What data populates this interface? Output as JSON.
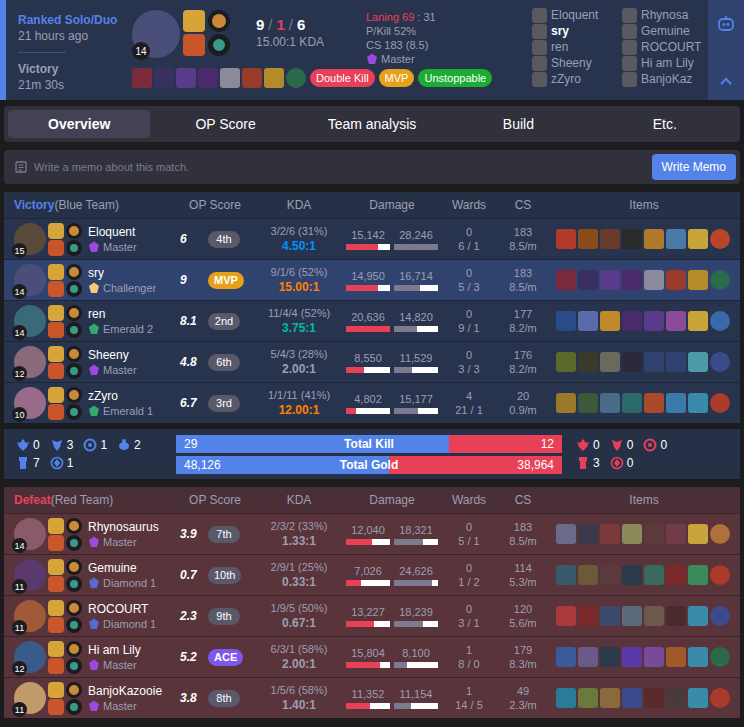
{
  "header": {
    "queue": "Ranked Solo/Duo",
    "time_ago": "21 hours ago",
    "result": "Victory",
    "duration": "21m 30s",
    "champion_level": "14",
    "portrait_color": "#4a4f7a",
    "kda_kills": "9",
    "kda_deaths": "1",
    "kda_assists": "6",
    "kda_separator": "/",
    "kda_ratio": "15.00:1 KDA",
    "laning": "Laning 69",
    "laning_rest": ": 31",
    "pkill": "P/Kill 52%",
    "cs": "CS 183 (8.5)",
    "rank": "Master",
    "rank_color": "#9d48e0",
    "items": [
      "#7a2a3a",
      "#3a3060",
      "#5a3a8a",
      "#4a2a6a",
      "#8a8a9a",
      "#9a3a2a",
      "#b58b2a",
      "#2a6a4a"
    ],
    "badges": [
      {
        "label": "Double Kill",
        "color": "#e84057"
      },
      {
        "label": "MVP",
        "color": "#e6a11b"
      },
      {
        "label": "Unstoppable",
        "color": "#1aad32"
      }
    ],
    "player_columns": [
      [
        {
          "name": "Eloquent",
          "selected": false
        },
        {
          "name": "sry",
          "selected": true
        },
        {
          "name": "ren",
          "selected": false
        },
        {
          "name": "Sheeny",
          "selected": false
        },
        {
          "name": "zZyro",
          "selected": false
        }
      ],
      [
        {
          "name": "Rhynosa",
          "selected": false
        },
        {
          "name": "Gemuine",
          "selected": false
        },
        {
          "name": "ROCOURT",
          "selected": false
        },
        {
          "name": "Hi am Lily",
          "selected": false
        },
        {
          "name": "BanjoKaz",
          "selected": false
        }
      ]
    ]
  },
  "tabs": [
    {
      "label": "Overview",
      "selected": true
    },
    {
      "label": "OP Score",
      "selected": false
    },
    {
      "label": "Team analysis",
      "selected": false
    },
    {
      "label": "Build",
      "selected": false
    },
    {
      "label": "Etc.",
      "selected": false
    }
  ],
  "memo": {
    "placeholder": "Write a memo about this match.",
    "button": "Write Memo"
  },
  "teams": [
    {
      "result": "Victory",
      "label": "(Blue Team)",
      "kind": "win",
      "color": "#5383e8",
      "columns": [
        "OP Score",
        "KDA",
        "Damage",
        "Wards",
        "CS",
        "Items"
      ],
      "players": [
        {
          "name": "Eloquent",
          "rank": "Master",
          "rank_color": "#9d48e0",
          "level": "15",
          "portrait_color": "#5a4a3a",
          "op_score": "6",
          "badge": "4th",
          "badge_kind": "rank",
          "kda": "3/2/6 (31%)",
          "kda_ratio": "4.50:1",
          "ratio_color": "#0093ff",
          "damage_dealt": "15,142",
          "damage_taken": "28,246",
          "dealt_level": 0.73,
          "taken_level": 1.0,
          "wards": "0",
          "wards_detail": "6 / 1",
          "cs": "183",
          "cs_per_min": "8.5/m",
          "selected": false,
          "items": [
            "#b23a2a",
            "#8a4a1a",
            "#6a3a2a",
            "#2a2a2a",
            "#b07a2a",
            "#4a7aaa",
            "#c9a43a",
            "#b8452a"
          ]
        },
        {
          "name": "sry",
          "rank": "Challenger",
          "rank_color": "#f4c874",
          "level": "14",
          "portrait_color": "#4a4f7a",
          "op_score": "9",
          "badge": "MVP",
          "badge_kind": "mvp",
          "kda": "9/1/6 (52%)",
          "kda_ratio": "15.00:1",
          "ratio_color": "#ff8200",
          "damage_dealt": "14,950",
          "damage_taken": "16,714",
          "dealt_level": 0.72,
          "taken_level": 0.59,
          "wards": "0",
          "wards_detail": "5 / 3",
          "cs": "183",
          "cs_per_min": "8.5/m",
          "selected": true,
          "items": [
            "#7a2a3a",
            "#3a3060",
            "#5a3a8a",
            "#4a2a6a",
            "#8a8a9a",
            "#9a3a2a",
            "#b58b2a",
            "#2a6a4a"
          ]
        },
        {
          "name": "ren",
          "rank": "Emerald 2",
          "rank_color": "#2dac6a",
          "level": "14",
          "portrait_color": "#3a6a7a",
          "op_score": "8.1",
          "badge": "2nd",
          "badge_kind": "rank",
          "kda": "11/4/4 (52%)",
          "kda_ratio": "3.75:1",
          "ratio_color": "#00bba3",
          "damage_dealt": "20,636",
          "damage_taken": "14,820",
          "dealt_level": 1.0,
          "taken_level": 0.52,
          "wards": "0",
          "wards_detail": "9 / 1",
          "cs": "177",
          "cs_per_min": "8.2/m",
          "selected": false,
          "items": [
            "#2a4a8a",
            "#5a6aaa",
            "#c08a2a",
            "#4a2a6a",
            "#5a3a8a",
            "#8a4a9a",
            "#c9a43a",
            "#3a6aaa"
          ]
        },
        {
          "name": "Sheeny",
          "rank": "Master",
          "rank_color": "#9d48e0",
          "level": "12",
          "portrait_color": "#8a6a7a",
          "op_score": "4.8",
          "badge": "6th",
          "badge_kind": "rank",
          "kda": "5/4/3 (28%)",
          "kda_ratio": "2.00:1",
          "ratio_color": "#9e9eb1",
          "damage_dealt": "8,550",
          "damage_taken": "11,529",
          "dealt_level": 0.41,
          "taken_level": 0.41,
          "wards": "0",
          "wards_detail": "3 / 3",
          "cs": "176",
          "cs_per_min": "8.2/m",
          "selected": false,
          "items": [
            "#5a6a2a",
            "#3a3a2a",
            "#6a6a5a",
            "#2a2a3a",
            null,
            null,
            "#4a9aaa",
            "#3a4a8a"
          ]
        },
        {
          "name": "zZyro",
          "rank": "Emerald 1",
          "rank_color": "#2dac6a",
          "level": "10",
          "portrait_color": "#9a6a8a",
          "op_score": "6.7",
          "badge": "3rd",
          "badge_kind": "rank",
          "kda": "1/1/11 (41%)",
          "kda_ratio": "12.00:1",
          "ratio_color": "#ff8200",
          "damage_dealt": "4,802",
          "damage_taken": "15,177",
          "dealt_level": 0.23,
          "taken_level": 0.54,
          "wards": "4",
          "wards_detail": "21 / 1",
          "cs": "20",
          "cs_per_min": "0.9/m",
          "selected": false,
          "items": [
            "#9a7a2a",
            "#3a5a3a",
            "#4a6a8a",
            "#2a6a6a",
            "#aa4a2a",
            "#3a7aaa",
            "#3a8aaa",
            "#aa3a2a"
          ]
        }
      ]
    },
    {
      "result": "Defeat",
      "label": "(Red Team)",
      "kind": "loss",
      "color": "#e84057",
      "columns": [
        "OP Score",
        "KDA",
        "Damage",
        "Wards",
        "CS",
        "Items"
      ],
      "players": [
        {
          "name": "Rhynosaurus",
          "rank": "Master",
          "rank_color": "#9d48e0",
          "level": "14",
          "portrait_color": "#8a5a6a",
          "op_score": "3.9",
          "badge": "7th",
          "badge_kind": "rank",
          "kda": "2/3/2 (33%)",
          "kda_ratio": "1.33:1",
          "ratio_color": "#9e9eb1",
          "damage_dealt": "12,040",
          "damage_taken": "18,321",
          "dealt_level": 0.58,
          "taken_level": 0.65,
          "wards": "0",
          "wards_detail": "5 / 1",
          "cs": "183",
          "cs_per_min": "8.5/m",
          "selected": false,
          "items": [
            "#6a6a8a",
            "#3a3a4a",
            "#7a3a3a",
            "#8a8a5a",
            "#5a3a3a",
            null,
            "#c9a43a",
            "#b0703a"
          ]
        },
        {
          "name": "Gemuine",
          "rank": "Diamond 1",
          "rank_color": "#576bce",
          "level": "11",
          "portrait_color": "#5a3a6a",
          "op_score": "0.7",
          "badge": "10th",
          "badge_kind": "rank",
          "kda": "2/9/1 (25%)",
          "kda_ratio": "0.33:1",
          "ratio_color": "#9e9eb1",
          "damage_dealt": "7,026",
          "damage_taken": "24,626",
          "dealt_level": 0.34,
          "taken_level": 0.87,
          "wards": "0",
          "wards_detail": "1 / 2",
          "cs": "114",
          "cs_per_min": "5.3/m",
          "selected": false,
          "items": [
            "#3a5a6a",
            "#6a5a3a",
            "#5a3a3a",
            "#2a3a4a",
            "#3a6a5a",
            "#7a2a2a",
            "#3a8a5a",
            "#aa3a2a"
          ]
        },
        {
          "name": "ROCOURT",
          "rank": "Diamond 1",
          "rank_color": "#576bce",
          "level": "11",
          "portrait_color": "#a05a3a",
          "op_score": "2.3",
          "badge": "9th",
          "badge_kind": "rank",
          "kda": "1/9/5 (50%)",
          "kda_ratio": "0.67:1",
          "ratio_color": "#9e9eb1",
          "damage_dealt": "13,227",
          "damage_taken": "18,239",
          "dealt_level": 0.64,
          "taken_level": 0.65,
          "wards": "0",
          "wards_detail": "3 / 1",
          "cs": "120",
          "cs_per_min": "5.6/m",
          "selected": false,
          "items": [
            "#aa3a3a",
            "#7a2a2a",
            "#3a4a6a",
            "#5a6a7a",
            "#6a5a4a",
            "#4a2a2a",
            "#3a8aaa",
            "#3a4a8a"
          ]
        },
        {
          "name": "Hi am Lily",
          "rank": "Master",
          "rank_color": "#9d48e0",
          "level": "12",
          "portrait_color": "#3a5a8a",
          "op_score": "5.2",
          "badge": "ACE",
          "badge_kind": "ace",
          "kda": "6/3/1 (58%)",
          "kda_ratio": "2.00:1",
          "ratio_color": "#9e9eb1",
          "damage_dealt": "15,804",
          "damage_taken": "8,100",
          "dealt_level": 0.77,
          "taken_level": 0.29,
          "wards": "1",
          "wards_detail": "8 / 0",
          "cs": "179",
          "cs_per_min": "8.3/m",
          "selected": false,
          "items": [
            "#3a5a9a",
            "#6a5a8a",
            "#2a3a4a",
            "#5a3aaa",
            "#7a4a9a",
            "#a05a2a",
            "#3a8aaa",
            "#2a6a4a"
          ]
        },
        {
          "name": "BanjoKazooie",
          "rank": "Master",
          "rank_color": "#9d48e0",
          "level": "11",
          "portrait_color": "#c09a6a",
          "op_score": "3.8",
          "badge": "8th",
          "badge_kind": "rank",
          "kda": "1/5/6 (58%)",
          "kda_ratio": "1.40:1",
          "ratio_color": "#9e9eb1",
          "damage_dealt": "11,352",
          "damage_taken": "11,154",
          "dealt_level": 0.55,
          "taken_level": 0.39,
          "wards": "1",
          "wards_detail": "14 / 5",
          "cs": "49",
          "cs_per_min": "2.3/m",
          "selected": false,
          "items": [
            "#2a7a9a",
            "#6a7a3a",
            "#8a6a3a",
            "#3a4a8a",
            "#5a2a2a",
            "#4a3a3a",
            "#3a8aaa",
            "#aa3a2a"
          ]
        }
      ]
    }
  ],
  "summary": {
    "left": {
      "color": "#5383e8",
      "top": [
        {
          "kind": "baron",
          "count": "0"
        },
        {
          "kind": "dragon",
          "count": "3"
        },
        {
          "kind": "herald",
          "count": "1"
        },
        {
          "kind": "grub",
          "count": "2"
        }
      ],
      "bottom": [
        {
          "kind": "tower",
          "count": "7"
        },
        {
          "kind": "inhibitor",
          "count": "1"
        }
      ]
    },
    "right": {
      "color": "#e84057",
      "top": [
        {
          "kind": "baron",
          "count": "0"
        },
        {
          "kind": "dragon",
          "count": "0"
        },
        {
          "kind": "herald",
          "count": "0"
        }
      ],
      "bottom": [
        {
          "kind": "tower",
          "count": "3"
        },
        {
          "kind": "inhibitor",
          "count": "0"
        }
      ]
    },
    "bars": [
      {
        "label": "Total Kill",
        "blue": "29",
        "red": "12",
        "level": 0.707
      },
      {
        "label": "Total Gold",
        "blue": "48,126",
        "red": "38,964",
        "level": 0.553
      }
    ]
  }
}
